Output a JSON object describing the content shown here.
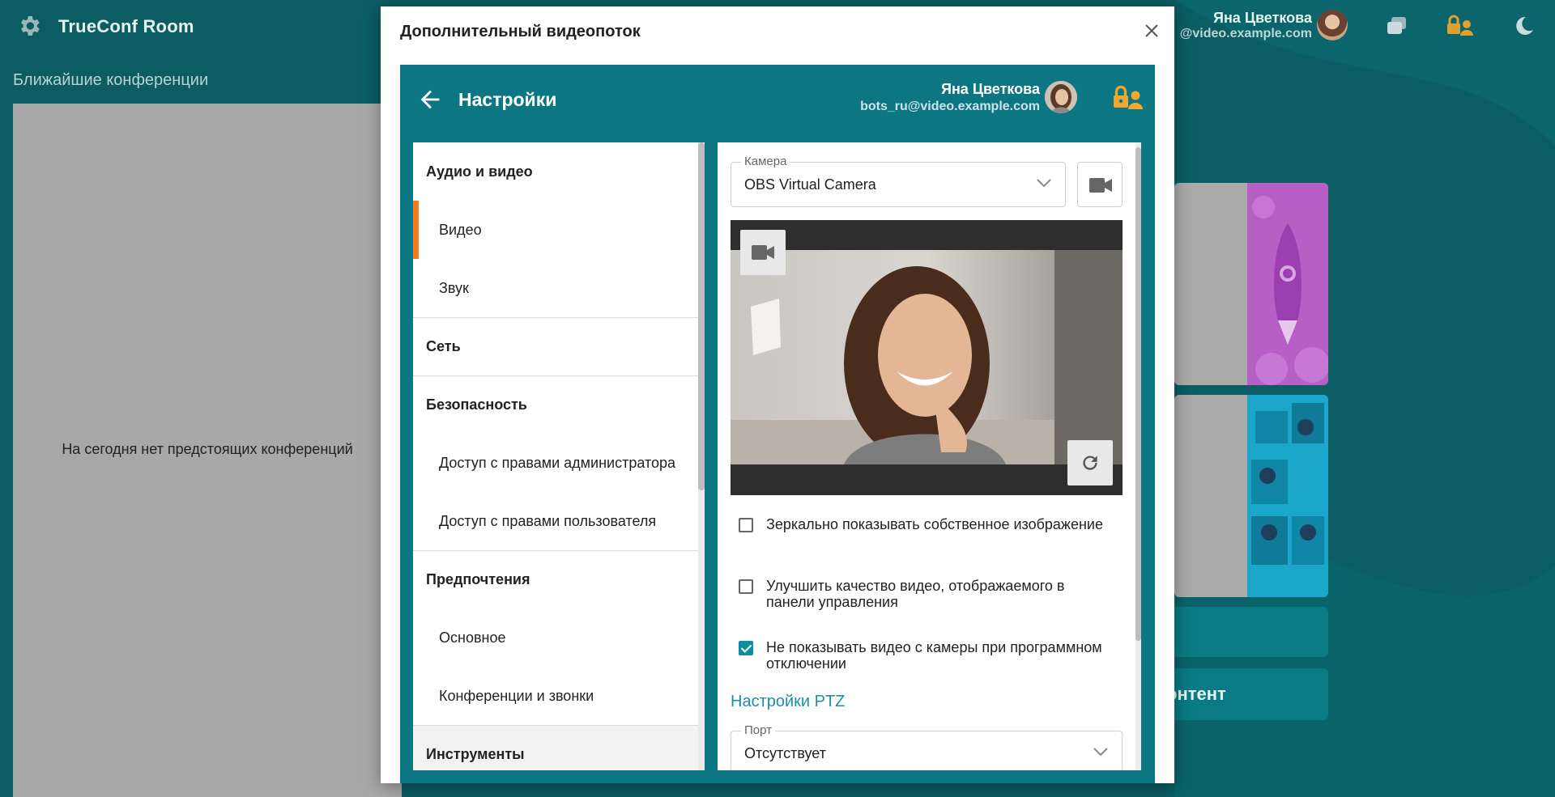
{
  "app": {
    "title": "TrueConf Room",
    "user_name": "Яна Цветкова",
    "user_email_partial": "@video.example.com",
    "section_title": "Ближайшие конференции",
    "no_conferences": "На сегодня нет предстоящих конференций",
    "content_button_partial": "онтент"
  },
  "dialog": {
    "title": "Дополнительный видеопоток",
    "close_icon": "close-icon"
  },
  "settings": {
    "title": "Настройки",
    "user_name": "Яна Цветкова",
    "user_email": "bots_ru@video.example.com",
    "menu": [
      {
        "label": "Аудио и видео",
        "type": "head"
      },
      {
        "label": "Видео",
        "type": "sub",
        "active": true
      },
      {
        "label": "Звук",
        "type": "sub"
      },
      {
        "label": "Сеть",
        "type": "head"
      },
      {
        "label": "Безопасность",
        "type": "head"
      },
      {
        "label": "Доступ с правами администратора",
        "type": "sub"
      },
      {
        "label": "Доступ с правами пользователя",
        "type": "sub"
      },
      {
        "label": "Предпочтения",
        "type": "head"
      },
      {
        "label": "Основное",
        "type": "sub"
      },
      {
        "label": "Конференции и звонки",
        "type": "sub"
      },
      {
        "label": "Инструменты",
        "type": "head"
      }
    ],
    "camera": {
      "label": "Камера",
      "value": "OBS Virtual Camera"
    },
    "checkboxes": [
      {
        "label": "Зеркально показывать собственное изображение",
        "checked": false
      },
      {
        "label": "Улучшить качество видео, отображаемого в панели управления",
        "checked": false
      },
      {
        "label": "Не показывать видео с камеры при программном отключении",
        "checked": true
      }
    ],
    "ptz_link": "Настройки PTZ",
    "port": {
      "label": "Порт",
      "value": "Отсутствует"
    }
  },
  "colors": {
    "accent": "#0d7683",
    "active_marker": "#f47a1f",
    "link": "#1a8fa6"
  }
}
